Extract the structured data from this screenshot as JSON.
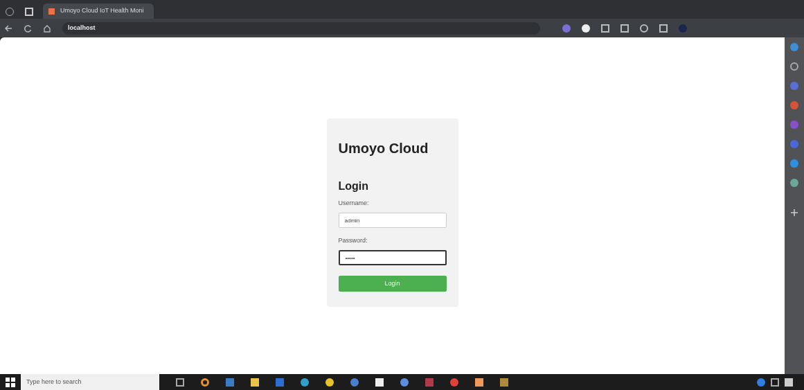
{
  "browser": {
    "tab_title": "Umoyo Cloud IoT Health Moni",
    "address": "localhost"
  },
  "login": {
    "brand": "Umoyo Cloud",
    "heading": "Login",
    "fields": [
      {
        "label": "Username:",
        "value": "admin",
        "focused": false
      },
      {
        "label": "Password:",
        "value": "•••••",
        "focused": true
      }
    ],
    "button": "Login"
  },
  "taskbar": {
    "search_placeholder": "Type here to search"
  }
}
